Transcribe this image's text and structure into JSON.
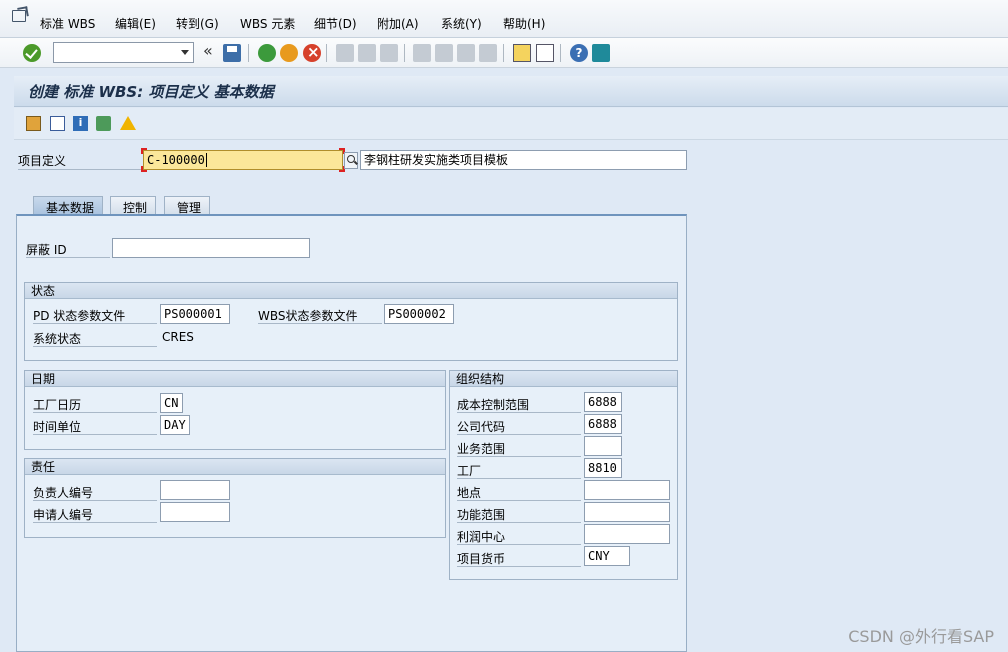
{
  "menu": {
    "items": [
      "标准 WBS",
      "编辑(E)",
      "转到(G)",
      "WBS 元素",
      "细节(D)",
      "附加(A)",
      "系统(Y)",
      "帮助(H)"
    ]
  },
  "toolbar": {
    "command_value": ""
  },
  "title": "创建 标准 WBS: 项目定义 基本数据",
  "project": {
    "label": "项目定义",
    "value": "C-100000",
    "description": "李钢柱研发实施类项目模板"
  },
  "tabs": [
    "基本数据",
    "控制",
    "管理"
  ],
  "basic": {
    "mask_id_label": "屏蔽 ID",
    "mask_id_value": ""
  },
  "status": {
    "header": "状态",
    "pd_profile_label": "PD 状态参数文件",
    "pd_profile_value": "PS000001",
    "wbs_profile_label": "WBS状态参数文件",
    "wbs_profile_value": "PS000002",
    "system_status_label": "系统状态",
    "system_status_value": "CRES"
  },
  "dates": {
    "header": "日期",
    "factory_calendar_label": "工厂日历",
    "factory_calendar_value": "CN",
    "time_unit_label": "时间单位",
    "time_unit_value": "DAY"
  },
  "responsibility": {
    "header": "责任",
    "person_resp_label": "负责人编号",
    "person_resp_value": "",
    "applicant_label": "申请人编号",
    "applicant_value": ""
  },
  "org": {
    "header": "组织结构",
    "controlling_area_label": "成本控制范围",
    "controlling_area_value": "6888",
    "company_code_label": "公司代码",
    "company_code_value": "6888",
    "business_area_label": "业务范围",
    "business_area_value": "",
    "plant_label": "工厂",
    "plant_value": "8810",
    "location_label": "地点",
    "location_value": "",
    "functional_area_label": "功能范围",
    "functional_area_value": "",
    "profit_center_label": "利润中心",
    "profit_center_value": "",
    "currency_label": "项目货币",
    "currency_value": "CNY"
  },
  "watermark": "CSDN @外行看SAP"
}
